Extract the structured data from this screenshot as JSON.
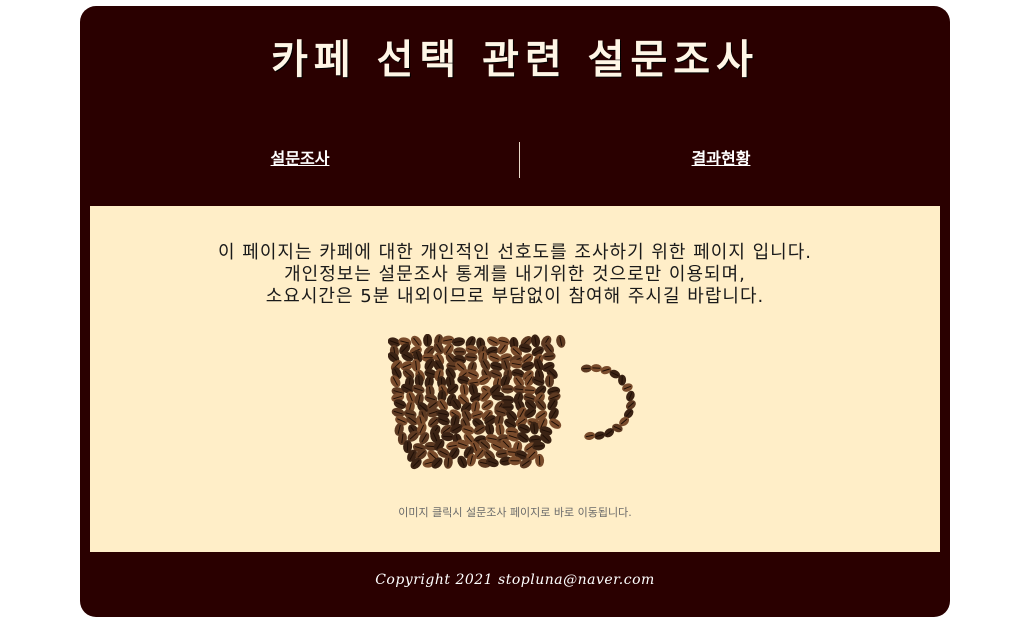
{
  "header": {
    "title": "카페 선택 관련 설문조사"
  },
  "nav": {
    "survey_label": "설문조사",
    "results_label": "결과현황"
  },
  "main": {
    "intro_lines": [
      "이 페이지는 카페에 대한 개인적인 선호도를 조사하기 위한 페이지 입니다.",
      "개인정보는 설문조사 통계를 내기위한 것으로만 이용되며,",
      "소요시간은 5분 내외이므로 부담없이 참여해 주시길 바랍니다."
    ],
    "image_icon": "coffee-bean-cup-icon",
    "image_hint": "이미지 클릭시 설문조사 페이지로 바로 이동됩니다."
  },
  "footer": {
    "copyright": "Copyright 2021 stopluna@naver.com"
  },
  "colors": {
    "frame": "#2a0000",
    "content_bg": "#ffeec8",
    "bean_dark": "#3b2314",
    "bean_mid": "#5e3a22",
    "bean_light": "#7a4c2c"
  }
}
